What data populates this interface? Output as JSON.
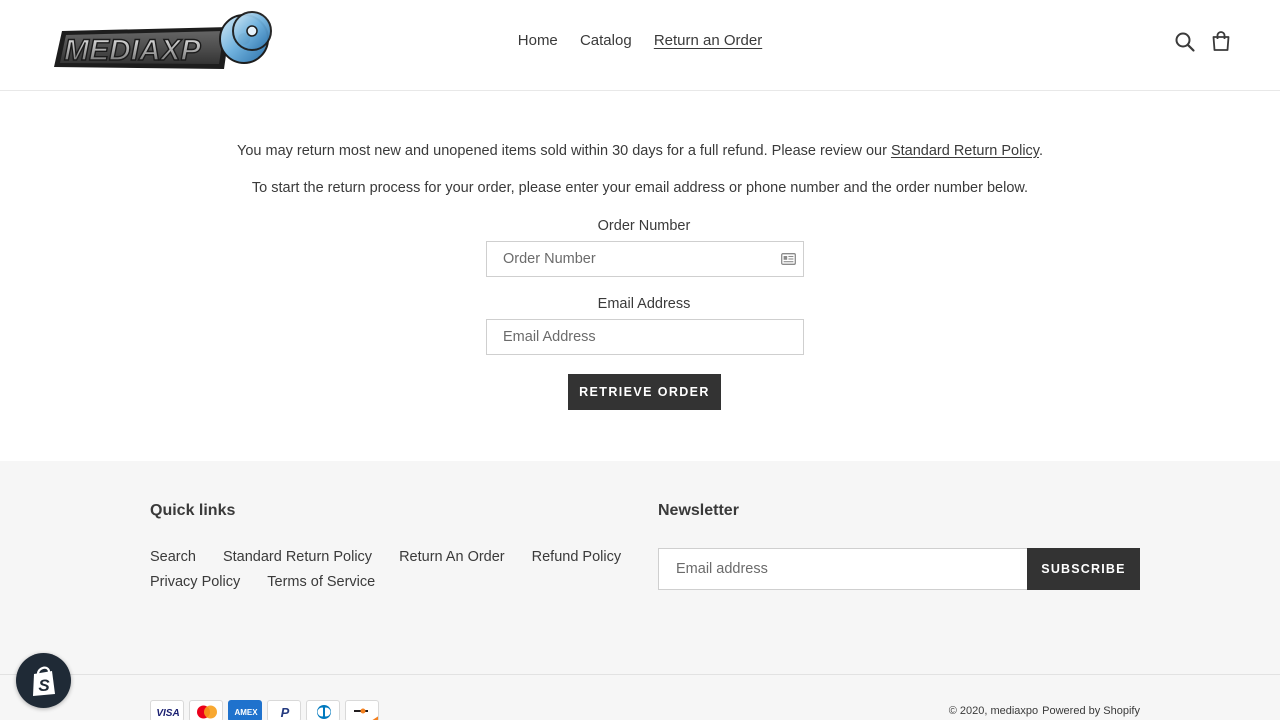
{
  "header": {
    "logo_text": "MEDIAXP",
    "nav": [
      {
        "label": "Home"
      },
      {
        "label": "Catalog"
      },
      {
        "label": "Return an Order"
      }
    ],
    "search_icon": "search-icon",
    "cart_icon": "cart-icon"
  },
  "main": {
    "intro_prefix": "You may return most new and unopened items sold within 30 days for a full refund. Please review our ",
    "intro_link": "Standard Return Policy",
    "intro_suffix": ".",
    "instructions": "To start the return process for your order, please enter your email address or phone number and the order number below.",
    "order_label": "Order Number",
    "order_placeholder": "Order Number",
    "email_label": "Email Address",
    "email_placeholder": "Email Address",
    "retrieve_label": "RETRIEVE ORDER"
  },
  "footer": {
    "quick_links_title": "Quick links",
    "quick_links": [
      {
        "label": "Search"
      },
      {
        "label": "Standard Return Policy"
      },
      {
        "label": "Return An Order"
      },
      {
        "label": "Refund Policy"
      },
      {
        "label": "Privacy Policy"
      },
      {
        "label": "Terms of Service"
      }
    ],
    "newsletter_title": "Newsletter",
    "newsletter_placeholder": "Email address",
    "subscribe_label": "SUBSCRIBE",
    "payment_icons": [
      "visa-icon",
      "mastercard-icon",
      "amex-icon",
      "paypal-icon",
      "diners-club-icon",
      "discover-icon"
    ],
    "payment_texts": {
      "visa": "VISA",
      "amex": "AMEX",
      "paypal": "P"
    },
    "copyright": "© 2020, mediaxpo",
    "powered_by": "Powered by Shopify"
  },
  "colors": {
    "button_bg": "#333333",
    "footer_bg": "#f6f6f6",
    "text": "#3a3a3a",
    "shop_badge_bg": "#1f2a36"
  }
}
